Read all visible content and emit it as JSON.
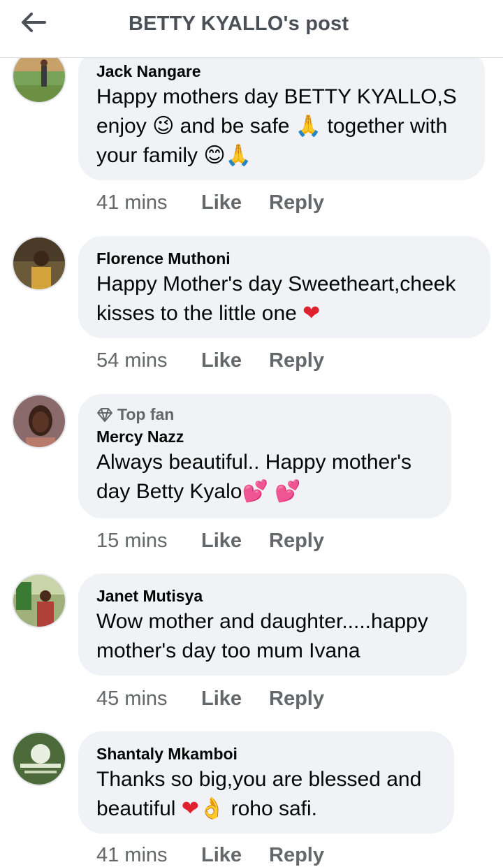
{
  "header": {
    "title": "BETTY KYALLO's post"
  },
  "actions": {
    "like": "Like",
    "reply": "Reply"
  },
  "comments": [
    {
      "author": "Jack Nangare",
      "top_fan": "",
      "text_1": "Happy mothers day BETTY KYALLO,S enjoy ",
      "emoji_1": "😉",
      "text_2": " and be safe ",
      "emoji_2": "🙏",
      "text_3": " together with your family ",
      "emoji_3": "😊🙏",
      "time": "41 mins"
    },
    {
      "author": "Florence Muthoni",
      "top_fan": "",
      "text_1": "Happy Mother's day Sweetheart,cheek kisses to the little one ",
      "emoji_1": "❤",
      "time": "54 mins"
    },
    {
      "author": "Mercy Nazz",
      "top_fan": "Top fan",
      "text_1": "Always beautiful.. Happy mother's day Betty Kyalo",
      "emoji_1": "💕 💕",
      "time": "15 mins"
    },
    {
      "author": "Janet Mutisya",
      "top_fan": "",
      "text_1": "Wow mother and daughter.....happy mother's day too mum Ivana",
      "time": "45 mins"
    },
    {
      "author": "Shantaly Mkamboi",
      "top_fan": "",
      "text_1": "Thanks so big,you are blessed and beautiful ",
      "emoji_1": "❤",
      "emoji_2": "👌",
      "text_2": " roho safi.",
      "time": "41 mins"
    }
  ]
}
